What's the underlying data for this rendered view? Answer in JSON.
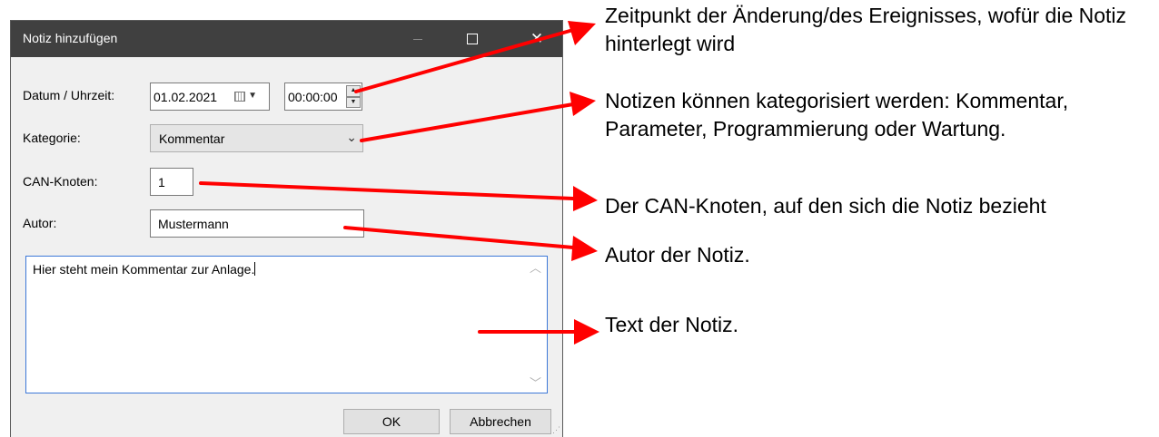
{
  "dialog": {
    "title": "Notiz hinzufügen",
    "close_glyph": "✕",
    "date_label": "Datum / Uhrzeit:",
    "date_value": "01.02.2021",
    "time_value": "00:00:00",
    "category_label": "Kategorie:",
    "category_value": "Kommentar",
    "can_label": "CAN-Knoten:",
    "can_value": "1",
    "author_label": "Autor:",
    "author_value": "Mustermann",
    "note_text": "Hier steht mein Kommentar zur Anlage.",
    "ok_label": "OK",
    "cancel_label": "Abbrechen"
  },
  "annotations": [
    "Zeitpunkt der Änderung/des Ereignisses, wofür die Notiz hinterlegt wird",
    "Notizen können kategorisiert werden: Kommentar, Parameter, Programmierung oder Wartung.",
    "Der CAN-Knoten, auf den sich die Notiz bezieht",
    "Autor der Notiz.",
    "Text der Notiz."
  ],
  "colors": {
    "arrow": "#ff0000",
    "titlebar": "#404040",
    "dialog_bg": "#f0f0f0",
    "focus_border": "#3c78d8"
  }
}
